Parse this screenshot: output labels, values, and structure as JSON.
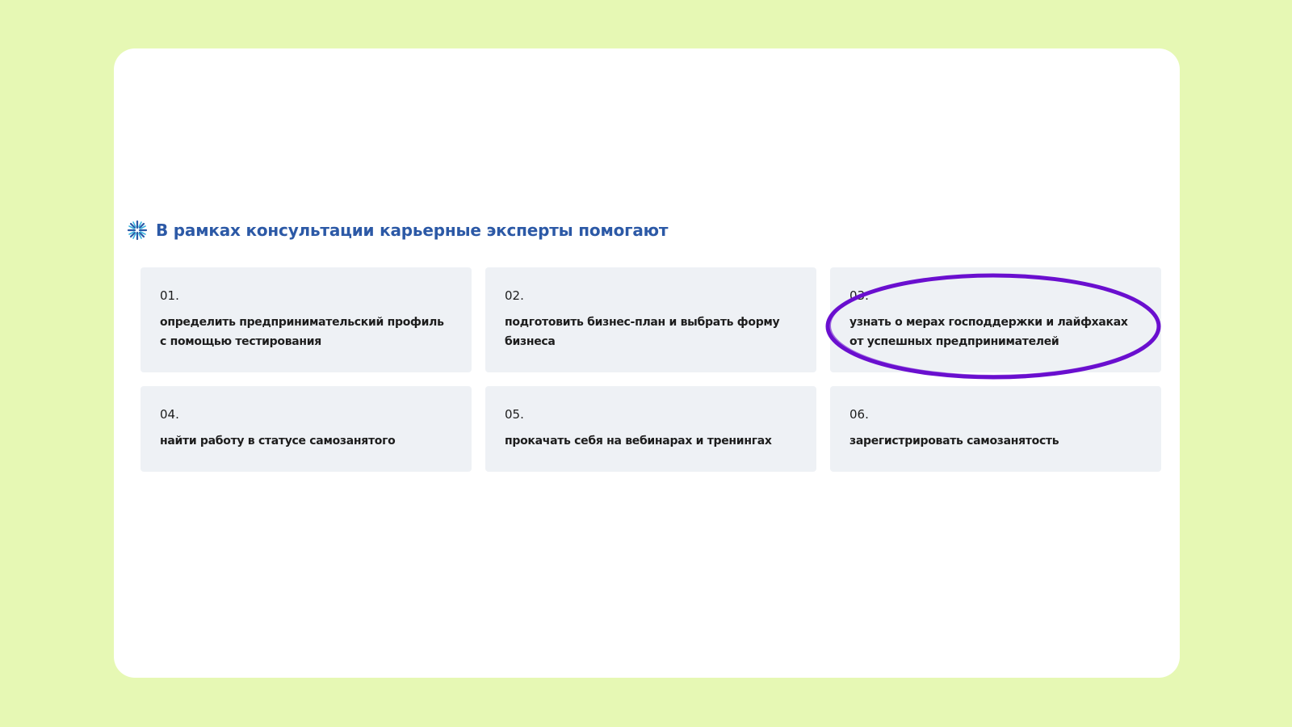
{
  "section": {
    "title": "В рамках консультации карьерные эксперты помогают",
    "icon": "snowflake-icon",
    "accent_color": "#2c59a6"
  },
  "cards": [
    {
      "number": "01.",
      "text": "определить предпринимательский профиль с помощью тестирования"
    },
    {
      "number": "02.",
      "text": "подготовить бизнес-план и выбрать форму бизнеса"
    },
    {
      "number": "03.",
      "text": "узнать о мерах господдержки и лайфхаках от успешных предпринимателей"
    },
    {
      "number": "04.",
      "text": "найти работу в статусе самозанятого"
    },
    {
      "number": "05.",
      "text": "прокачать себя на вебинарах и тренингах"
    },
    {
      "number": "06.",
      "text": "зарегистрировать самозанятость"
    }
  ],
  "annotation": {
    "shape": "ellipse",
    "target": "card-03",
    "color": "#6a0fcf"
  },
  "colors": {
    "page_background": "#e6f8b4",
    "card_background": "#eef1f5"
  }
}
